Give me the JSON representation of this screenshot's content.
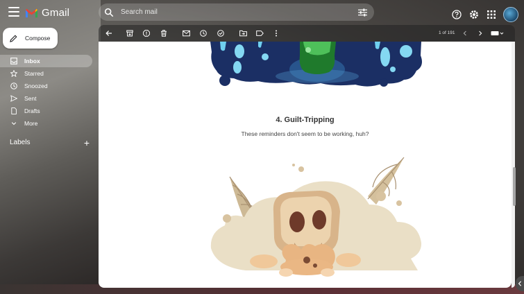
{
  "app": {
    "name": "Gmail"
  },
  "search": {
    "placeholder": "Search mail"
  },
  "compose": {
    "label": "Compose"
  },
  "sidebar": {
    "items": [
      {
        "label": "Inbox",
        "icon": "inbox-icon",
        "active": true
      },
      {
        "label": "Starred",
        "icon": "star-icon",
        "active": false
      },
      {
        "label": "Snoozed",
        "icon": "clock-icon",
        "active": false
      },
      {
        "label": "Sent",
        "icon": "send-icon",
        "active": false
      },
      {
        "label": "Drafts",
        "icon": "draft-icon",
        "active": false
      },
      {
        "label": "More",
        "icon": "chevron-down-icon",
        "active": false
      }
    ],
    "labels_heading": "Labels"
  },
  "toolbar": {
    "pager": "1 of 191"
  },
  "email": {
    "heading": "4. Guilt-Tripping",
    "subtext": "These reminders don't seem to be working, huh?"
  },
  "colors": {
    "accent_blue": "#1b2f64",
    "illustration_tan": "#d8c3a0",
    "slime_green": "#2f8a3a"
  }
}
